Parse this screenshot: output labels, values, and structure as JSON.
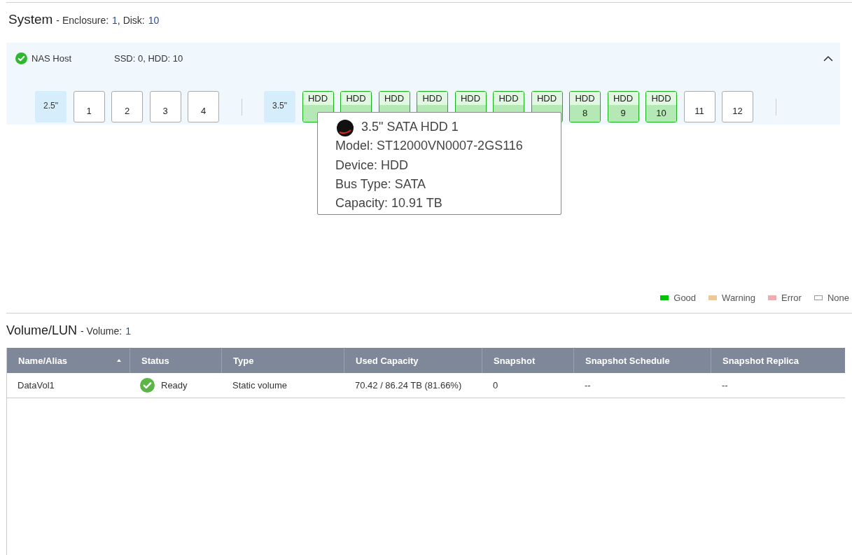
{
  "system": {
    "title": "System",
    "enclosure_label": "- Enclosure:",
    "enclosure_count": "1",
    "disk_label": ", Disk:",
    "disk_count": "10"
  },
  "host": {
    "name": "NAS Host",
    "summary": "SSD: 0, HDD: 10",
    "expanded": true,
    "groups": [
      {
        "label": "2.5\"",
        "bays": [
          {
            "kind": "empty",
            "number": "1"
          },
          {
            "kind": "empty",
            "number": "2"
          },
          {
            "kind": "empty",
            "number": "3"
          },
          {
            "kind": "empty",
            "number": "4"
          }
        ]
      },
      {
        "label": "3.5\"",
        "bays": [
          {
            "kind": "good",
            "type": "HDD"
          },
          {
            "kind": "good",
            "type": "HDD"
          },
          {
            "kind": "good",
            "type": "HDD"
          },
          {
            "kind": "good",
            "type": "HDD"
          },
          {
            "kind": "good",
            "type": "HDD"
          },
          {
            "kind": "good",
            "type": "HDD"
          },
          {
            "kind": "good",
            "type": "HDD"
          },
          {
            "kind": "good",
            "type": "HDD",
            "number": "8"
          },
          {
            "kind": "good",
            "type": "HDD",
            "number": "9"
          },
          {
            "kind": "good",
            "type": "HDD",
            "number": "10"
          },
          {
            "kind": "empty",
            "number": "11"
          },
          {
            "kind": "empty",
            "number": "12"
          }
        ]
      }
    ]
  },
  "tooltip": {
    "title": "3.5\" SATA HDD 1",
    "lines": [
      "Model: ST12000VN0007-2GS116",
      "Device: HDD",
      "Bus Type: SATA",
      "Capacity: 10.91 TB"
    ]
  },
  "legend": [
    {
      "label": "Good",
      "color": "#00c000"
    },
    {
      "label": "Warning",
      "color": "#ecc89a"
    },
    {
      "label": "Error",
      "color": "#efadad"
    },
    {
      "label": "None",
      "color": "#ffffff"
    }
  ],
  "volume": {
    "title": "Volume/LUN",
    "count_label": "- Volume:",
    "count": "1"
  },
  "table": {
    "columns": [
      {
        "label": "Name/Alias",
        "sorted": true
      },
      {
        "label": "Status",
        "sorted": false
      },
      {
        "label": "Type",
        "sorted": false
      },
      {
        "label": "Used Capacity",
        "sorted": false
      },
      {
        "label": "Snapshot",
        "sorted": false
      },
      {
        "label": "Snapshot Schedule",
        "sorted": false
      },
      {
        "label": "Snapshot Replica",
        "sorted": false
      }
    ],
    "rows": [
      {
        "name": "DataVol1",
        "status": "Ready",
        "type": "Static volume",
        "used": "70.42 / 86.24 TB (81.66%)",
        "snapshot": "0",
        "schedule": "--",
        "replica": "--"
      }
    ]
  }
}
